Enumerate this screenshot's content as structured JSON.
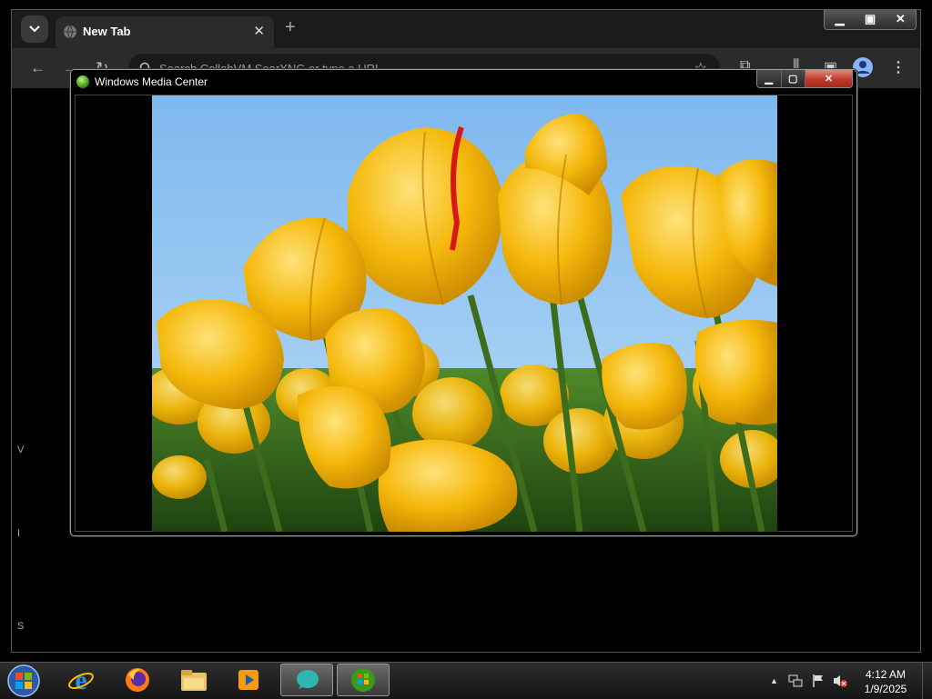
{
  "browser": {
    "tab_title": "New Tab",
    "tab_close": "✕",
    "new_tab": "+",
    "omnibox_placeholder": "Search CollabVM SearXNG or type a URL",
    "window_controls": {
      "minimize": "▁",
      "maximize": "▣",
      "close": "✕"
    }
  },
  "wmc": {
    "title": "Windows Media Center",
    "controls": {
      "minimize": "▁",
      "maximize": "▢",
      "close": "✕"
    },
    "photo_name": "tulips-photo"
  },
  "taskbar": {
    "items": [
      "internet-explorer",
      "firefox",
      "windows-explorer",
      "windows-media-player",
      "collabvm",
      "windows-media-center"
    ],
    "clock_time": "4:12 AM",
    "clock_date": "1/9/2025",
    "tray_arrow": "▲"
  },
  "colors": {
    "accent_green": "#3c9a1a",
    "close_red": "#c0392b",
    "tulip_yellow": "#f2b400",
    "sky": "#8fc3ee"
  }
}
